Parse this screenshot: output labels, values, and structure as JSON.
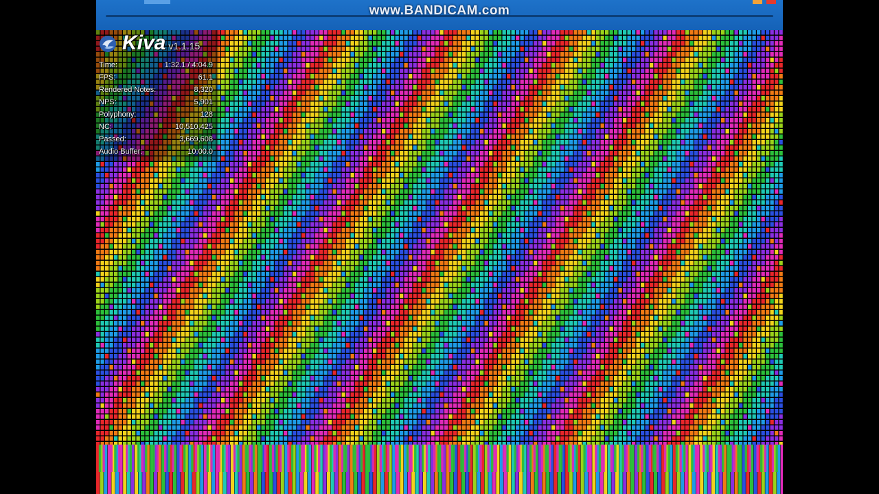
{
  "recorder": {
    "watermark": "www.BANDICAM.com"
  },
  "app": {
    "name": "Kiva",
    "version": "v1.1.15",
    "logo_icon": "kiva-logo-icon"
  },
  "stats": [
    {
      "label": "Time:",
      "value": "1:32.1 / 4:04.9"
    },
    {
      "label": "FPS:",
      "value": "61.1"
    },
    {
      "label": "Rendered Notes:",
      "value": "8,320"
    },
    {
      "label": "NPS:",
      "value": "5,901"
    },
    {
      "label": "Polyphony:",
      "value": "128"
    },
    {
      "label": "NC:",
      "value": "10,510,425"
    },
    {
      "label": "Passed:",
      "value": "3,669,608"
    },
    {
      "label": "Audio Buffer:",
      "value": "10:00.0"
    }
  ],
  "palette": [
    "#e8262a",
    "#f07a14",
    "#f2d21c",
    "#9ad21a",
    "#2cbf3a",
    "#1fc9b4",
    "#1e9be6",
    "#2a4fe0",
    "#8a2ee0",
    "#e02ab8"
  ],
  "colors": {
    "titlebar": "#1e72c9",
    "background": "#000000",
    "minimize": "#f2a23a",
    "close": "#e33b2e"
  }
}
